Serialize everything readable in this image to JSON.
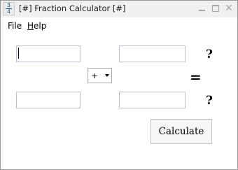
{
  "window": {
    "title": "[#] Fraction Calculator [#]",
    "icon": {
      "numerator": "3",
      "denominator": "4"
    },
    "controls": {
      "minimize_icon": "minimize-icon",
      "maximize_icon": "maximize-icon",
      "close_glyph": "✕"
    }
  },
  "menu": {
    "file_label": "File",
    "help_label_underlined": "H",
    "help_label_rest": "elp"
  },
  "form": {
    "operand1": {
      "numerator_value": "",
      "denominator_value": ""
    },
    "operand2": {
      "numerator_value": "",
      "denominator_value": ""
    },
    "operator": {
      "selected": "+"
    },
    "equals_sign": "=",
    "result": {
      "numerator": "?",
      "denominator": "?"
    },
    "calculate_label": "Calculate"
  },
  "colors": {
    "titlebar_bg": "#f0f0f0",
    "window_bg": "#ffffff",
    "input_border": "#b9c1cc",
    "icon_fg": "#1a4f6e"
  }
}
